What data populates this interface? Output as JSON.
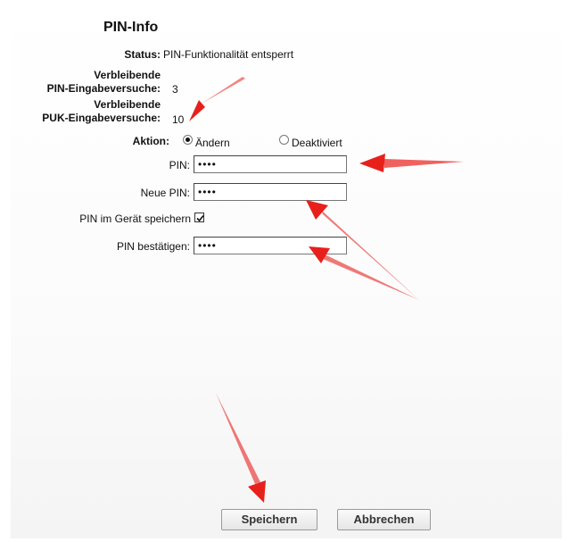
{
  "title": "PIN-Info",
  "status": {
    "label": "Status:",
    "value": "PIN-Funktionalität entsperrt"
  },
  "pin_attempts": {
    "label_line1": "Verbleibende",
    "label_line2": "PIN-Eingabeversuche:",
    "value": "3"
  },
  "puk_attempts": {
    "label_line1": "Verbleibende",
    "label_line2": "PUK-Eingabeversuche:",
    "value": "10"
  },
  "action": {
    "label": "Aktion:",
    "options": [
      {
        "label": "Ändern",
        "selected": true
      },
      {
        "label": "Deaktiviert",
        "selected": false
      }
    ]
  },
  "fields": {
    "pin": {
      "label": "PIN:",
      "value": "••••"
    },
    "new_pin": {
      "label": "Neue PIN:",
      "value": "••••"
    },
    "store_pin": {
      "label": "PIN im Gerät speichern",
      "checked": true
    },
    "confirm_pin": {
      "label": "PIN bestätigen:",
      "value": "••••"
    }
  },
  "buttons": {
    "save": "Speichern",
    "cancel": "Abbrechen"
  },
  "colors": {
    "arrow": "#e8201c"
  }
}
